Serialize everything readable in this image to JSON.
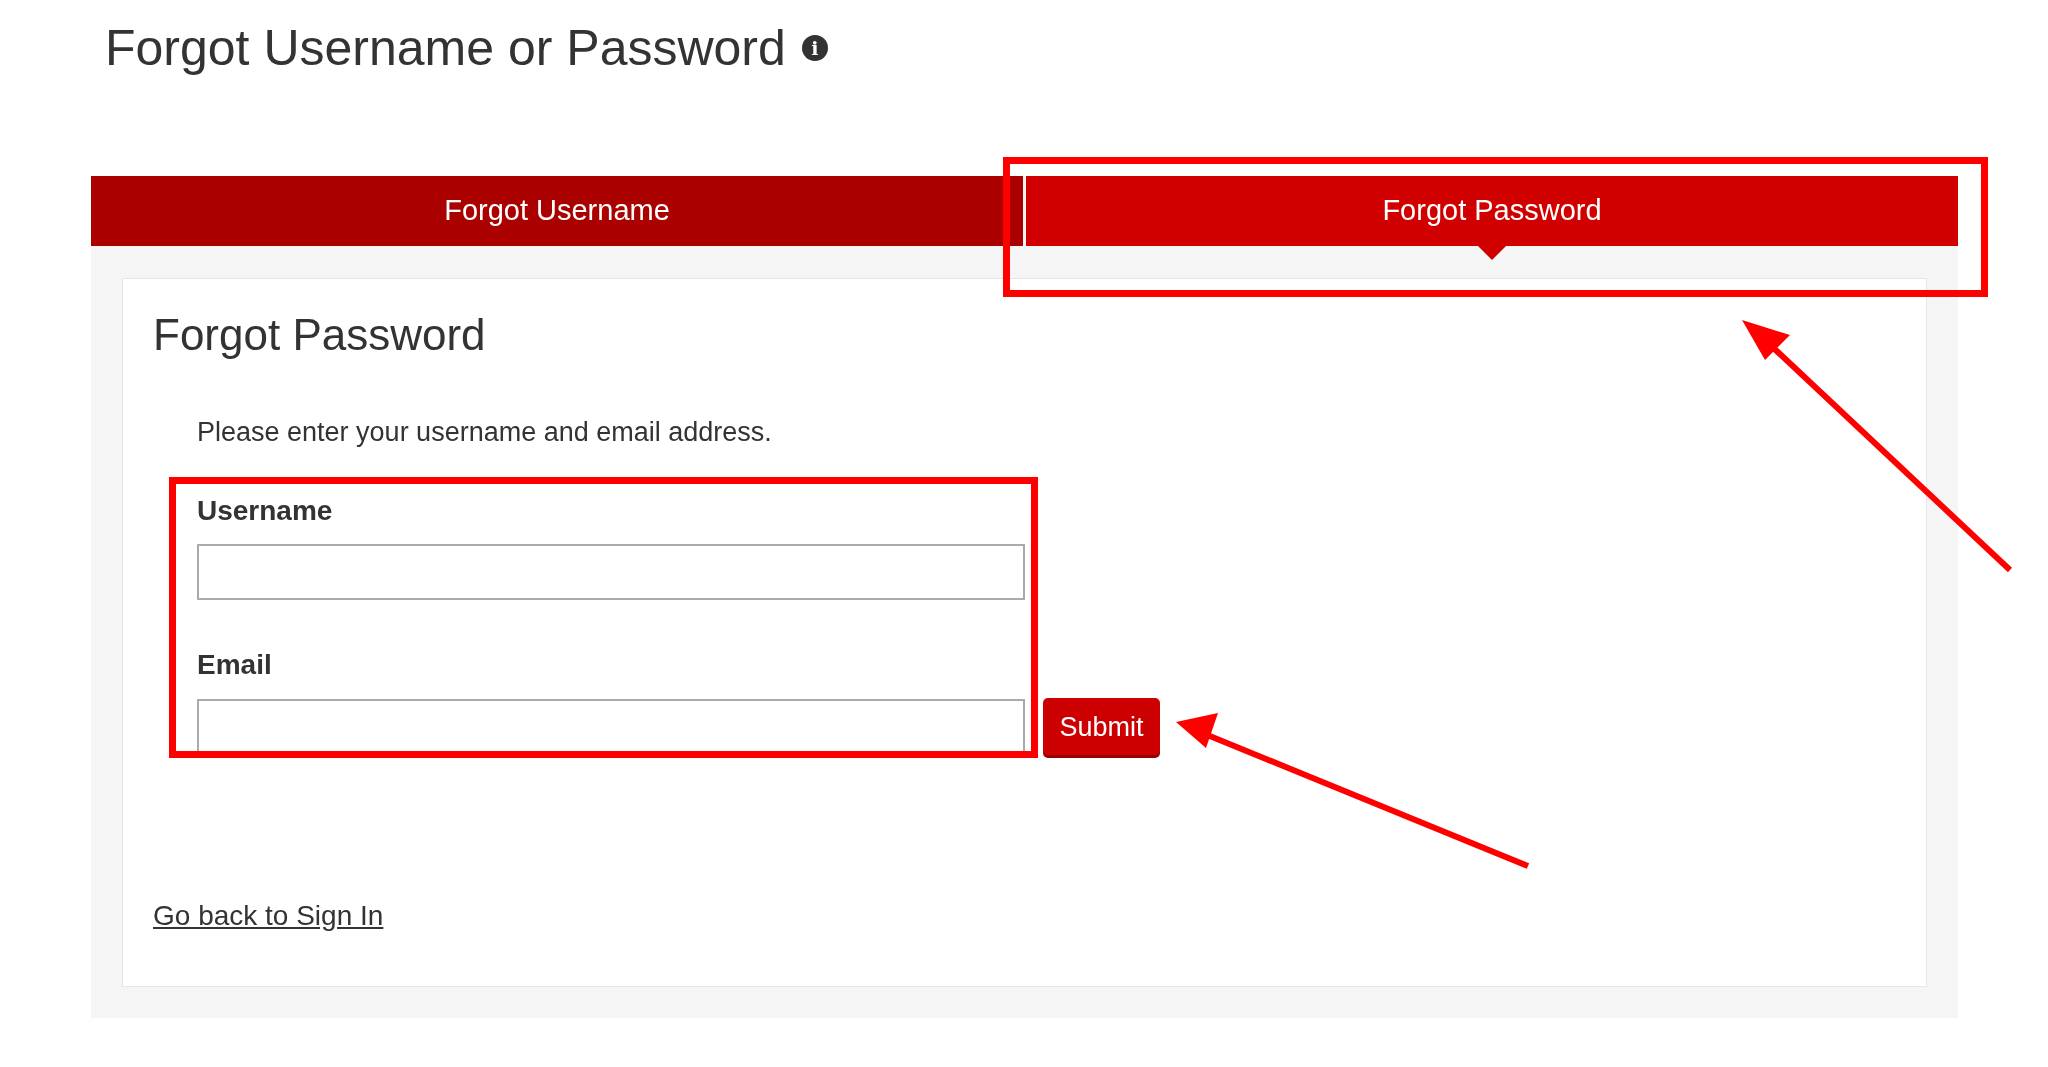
{
  "page": {
    "title": "Forgot Username or Password",
    "info_icon": "i"
  },
  "tabs": [
    {
      "label": "Forgot Username",
      "selected": false
    },
    {
      "label": "Forgot Password",
      "selected": true
    }
  ],
  "form": {
    "title": "Forgot Password",
    "instructions": "Please enter your username and email address.",
    "fields": [
      {
        "label": "Username"
      },
      {
        "label": "Email"
      }
    ],
    "submit": "Submit"
  },
  "link": "Go back to Sign In"
}
